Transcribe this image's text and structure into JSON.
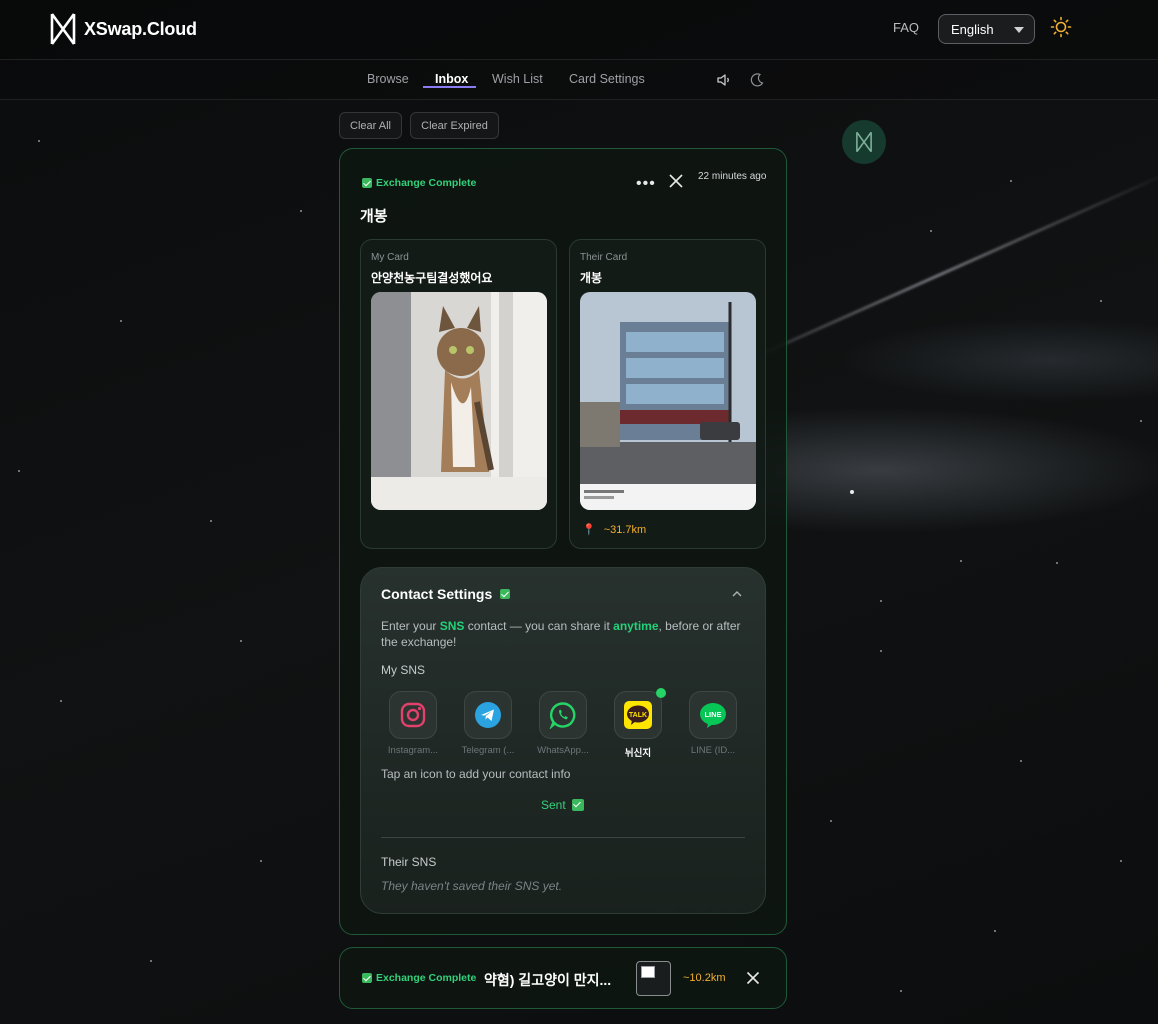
{
  "header": {
    "brand": "XSwap.Cloud",
    "faq_label": "FAQ",
    "language_selected": "English"
  },
  "nav": {
    "tabs": [
      {
        "label": "Browse"
      },
      {
        "label": "Inbox"
      },
      {
        "label": "Wish List"
      },
      {
        "label": "Card Settings"
      }
    ],
    "active_tab": "Inbox"
  },
  "actions": {
    "clear_all": "Clear All",
    "clear_expired": "Clear Expired"
  },
  "exchange": {
    "status": "Exchange Complete",
    "time_ago": "22 minutes ago",
    "title": "개봉",
    "my_card": {
      "label": "My Card",
      "title": "안양천농구팀결성했어요"
    },
    "their_card": {
      "label": "Their Card",
      "title": "개봉",
      "distance": "~31.7km"
    }
  },
  "contact_settings": {
    "title": "Contact Settings",
    "desc_prefix": "Enter your ",
    "desc_sns": "SNS",
    "desc_mid": " contact — you can share it ",
    "desc_anytime": "anytime",
    "desc_suffix": ", before or after the exchange!",
    "my_sns_label": "My SNS",
    "sns": [
      {
        "icon": "instagram-icon",
        "label": "Instagram..."
      },
      {
        "icon": "telegram-icon",
        "label": "Telegram (..."
      },
      {
        "icon": "whatsapp-icon",
        "label": "WhatsApp..."
      },
      {
        "icon": "kakaotalk-icon",
        "label": "뉘신지",
        "set": true
      },
      {
        "icon": "line-icon",
        "label": "LINE (ID..."
      }
    ],
    "tap_hint": "Tap an icon to add your contact info",
    "sent_label": "Sent",
    "their_sns_label": "Their SNS",
    "their_sns_note": "They haven't saved their SNS yet."
  },
  "second_exchange": {
    "status": "Exchange Complete",
    "title": "약혐) 길고양이 만지...",
    "distance": "~10.2km"
  },
  "colors": {
    "accent_green": "#33d17a",
    "distance_orange": "#f2b030",
    "tab_underline": "#8b7cf6",
    "card_border": "#1f5a38"
  }
}
